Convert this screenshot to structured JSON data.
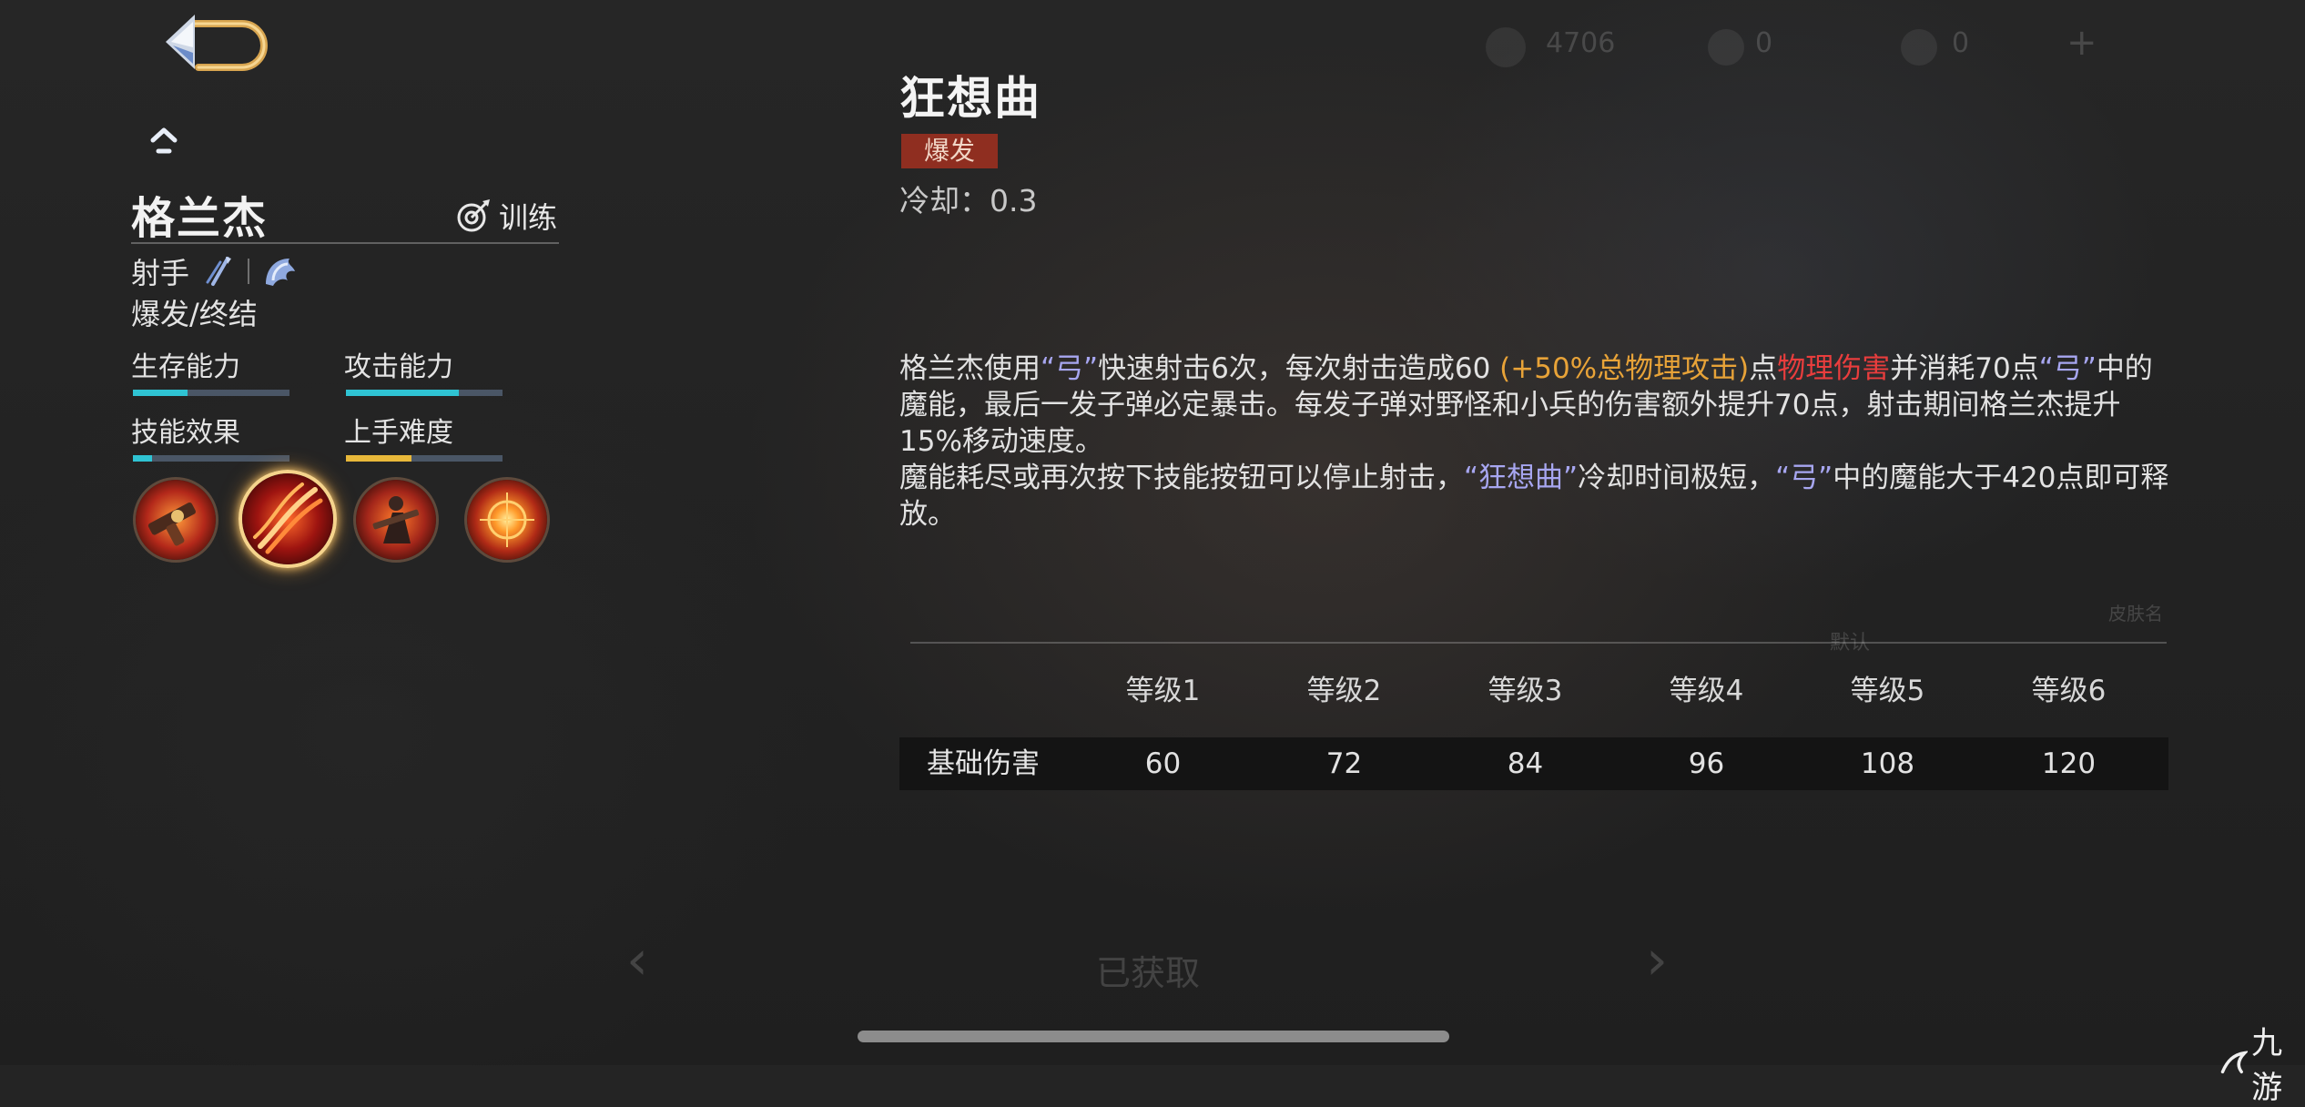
{
  "hero": {
    "name": "格兰杰",
    "train_label": "训练",
    "role": "射手",
    "position": "爆发/终结",
    "stats": [
      {
        "label": "生存能力",
        "value": 0.35,
        "color": "#2fc3d3"
      },
      {
        "label": "攻击能力",
        "value": 0.72,
        "color": "#2fc3d3"
      },
      {
        "label": "技能效果",
        "value": 0.12,
        "color": "#2fc3d3"
      },
      {
        "label": "上手难度",
        "value": 0.42,
        "color": "#e8b83a"
      }
    ],
    "skills": [
      {
        "name": "skill-1",
        "icon": "revolver-icon",
        "active": false
      },
      {
        "name": "skill-2",
        "icon": "flame-slash-icon",
        "active": true
      },
      {
        "name": "skill-3",
        "icon": "gunner-icon",
        "active": false
      },
      {
        "name": "skill-4",
        "icon": "target-burst-icon",
        "active": false
      }
    ]
  },
  "skill": {
    "name": "狂想曲",
    "tag": "爆发",
    "cooldown": "冷却：0.3",
    "description": {
      "p1": [
        {
          "t": "格兰杰使用",
          "s": ""
        },
        {
          "t": "“弓”",
          "s": "q"
        },
        {
          "t": "快速射击6次，每次射击造成60 ",
          "s": ""
        },
        {
          "t": "(+50%总物理攻击)",
          "s": "scale"
        },
        {
          "t": "点",
          "s": ""
        },
        {
          "t": "物理伤害",
          "s": "dmg"
        },
        {
          "t": "并消耗70点",
          "s": ""
        },
        {
          "t": "“弓”",
          "s": "q"
        },
        {
          "t": "中的魔能，最后一发子弹必定暴击。每发子弹对野怪和小兵的伤害额外提升70点，射击期间格兰杰提升15%移动速度。",
          "s": ""
        }
      ],
      "p2": [
        {
          "t": "魔能耗尽或再次按下技能按钮可以停止射击，",
          "s": ""
        },
        {
          "t": "“狂想曲”",
          "s": "q"
        },
        {
          "t": "冷却时间极短，",
          "s": ""
        },
        {
          "t": "“弓”",
          "s": "q"
        },
        {
          "t": "中的魔能大于420点即可释放。",
          "s": ""
        }
      ]
    }
  },
  "levels": {
    "headers": [
      "等级1",
      "等级2",
      "等级3",
      "等级4",
      "等级5",
      "等级6"
    ],
    "row_label": "基础伤害",
    "values": [
      "60",
      "72",
      "84",
      "96",
      "108",
      "120"
    ]
  },
  "background": {
    "faint_numbers": [
      "4706",
      "0",
      "0"
    ],
    "faint_center": "已获取",
    "faint_right_1": "默认",
    "faint_right_2": "皮肤名"
  },
  "watermark": "九游",
  "colors": {
    "accent_gold": "#d4a04a",
    "tag_bg": "#8f2e20",
    "quote_purple": "#a7a6f0",
    "scaling_orange": "#e8a338",
    "damage_red": "#e93d3d"
  }
}
